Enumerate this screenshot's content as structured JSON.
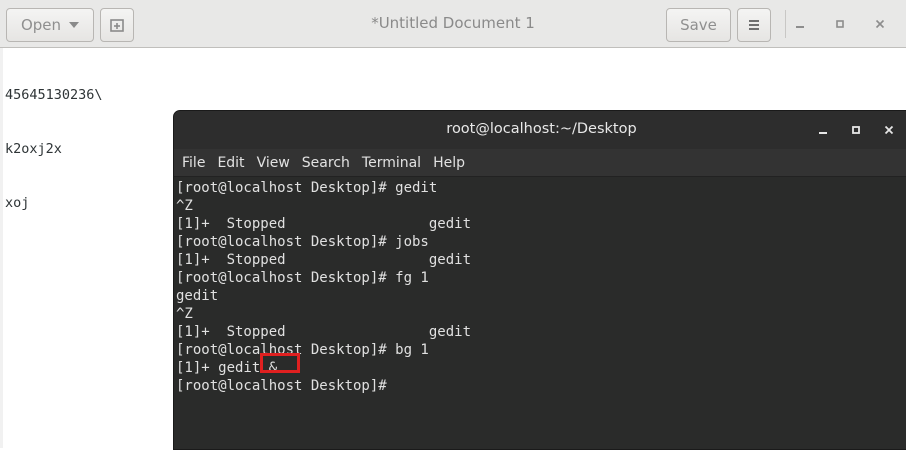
{
  "gedit": {
    "open_label": "Open",
    "title": "*Untitled Document 1",
    "save_label": "Save",
    "lines": [
      "45645130236\\",
      "k2oxj2x",
      "xoj"
    ]
  },
  "terminal": {
    "title": "root@localhost:~/Desktop",
    "menu": [
      "File",
      "Edit",
      "View",
      "Search",
      "Terminal",
      "Help"
    ],
    "lines": [
      "[root@localhost Desktop]# gedit",
      "^Z",
      "[1]+  Stopped                 gedit",
      "[root@localhost Desktop]# jobs",
      "[1]+  Stopped                 gedit",
      "[root@localhost Desktop]# fg 1",
      "gedit",
      "^Z",
      "[1]+  Stopped                 gedit",
      "[root@localhost Desktop]# bg 1",
      "[1]+ gedit &",
      "[root@localhost Desktop]#"
    ],
    "highlight_color": "#e02020"
  },
  "icons": {
    "new_tab": "new-document-icon",
    "menu": "hamburger-menu-icon",
    "minimize": "minimize-icon",
    "maximize": "maximize-icon",
    "close": "close-icon"
  }
}
